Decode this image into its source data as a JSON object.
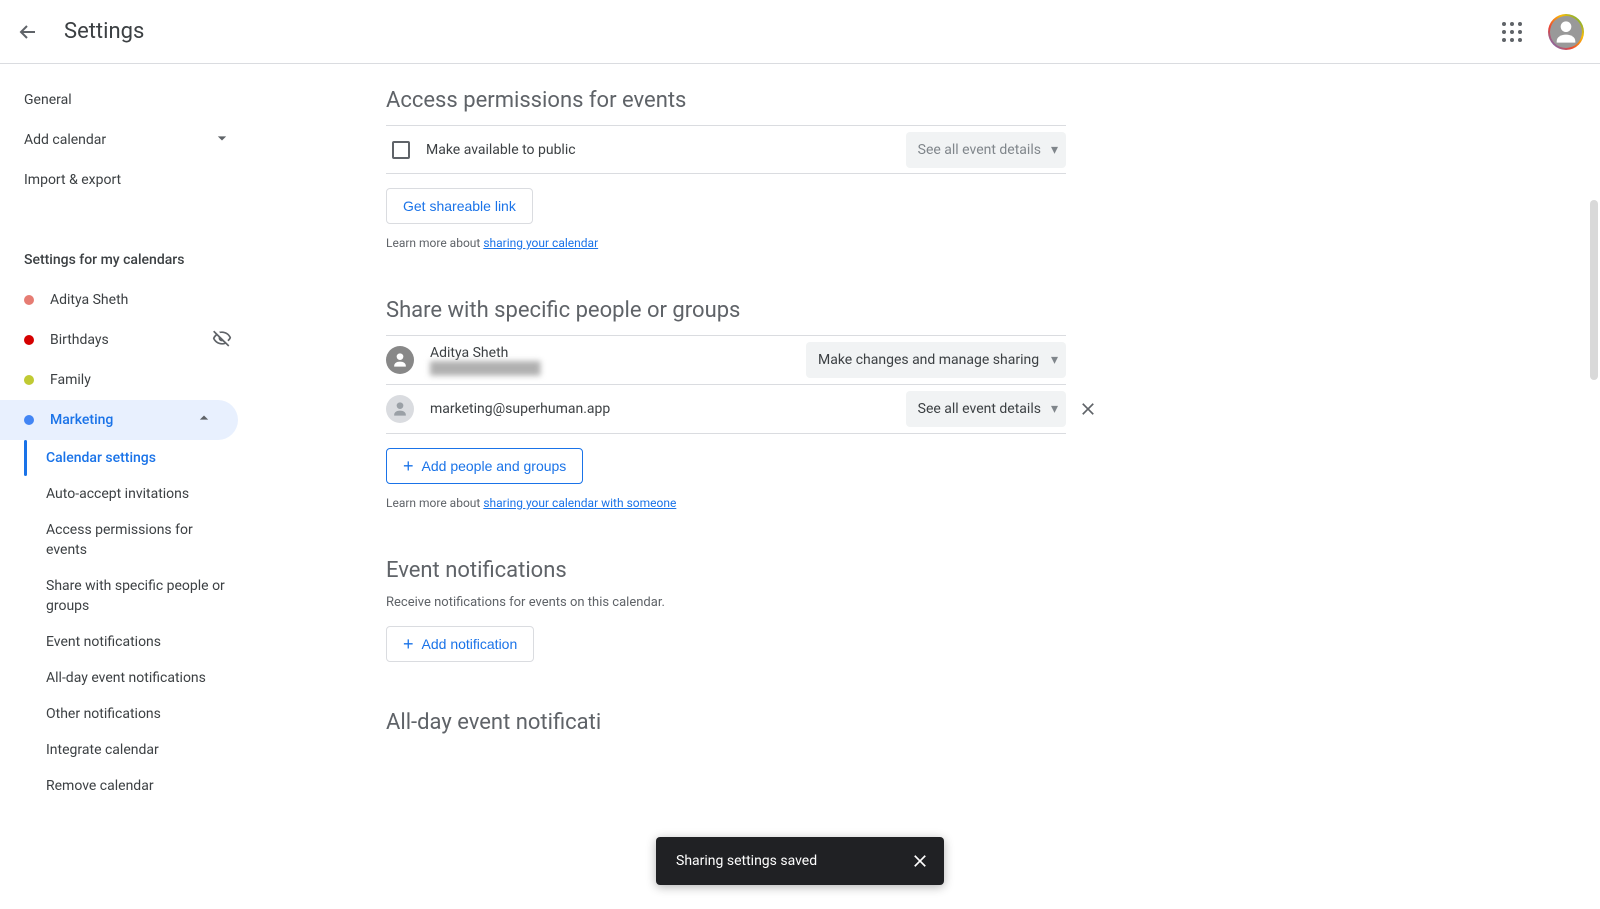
{
  "header": {
    "title": "Settings"
  },
  "sidebar": {
    "general": "General",
    "add_calendar": "Add calendar",
    "import_export": "Import & export",
    "settings_group_title": "Settings for my calendars",
    "calendars": [
      {
        "name": "Aditya Sheth",
        "color": "#e67c73"
      },
      {
        "name": "Birthdays",
        "color": "#d50000",
        "hidden": true
      },
      {
        "name": "Family",
        "color": "#c0ca33"
      },
      {
        "name": "Marketing",
        "color": "#4285f4",
        "selected": true
      }
    ],
    "sub_items": {
      "calendar_settings": "Calendar settings",
      "auto_accept": "Auto-accept invitations",
      "access_perm": "Access permissions for events",
      "share_specific": "Share with specific people or groups",
      "event_notif": "Event notifications",
      "allday_notif": "All-day event notifications",
      "other_notif": "Other notifications",
      "integrate": "Integrate calendar",
      "remove": "Remove calendar"
    }
  },
  "sections": {
    "access": {
      "title": "Access permissions for events",
      "public_label": "Make available to public",
      "visibility_dropdown": "See all event details",
      "shareable_btn": "Get shareable link",
      "learn_prefix": "Learn more about ",
      "learn_link": "sharing your calendar"
    },
    "share": {
      "title": "Share with specific people or groups",
      "owner_name": "Aditya Sheth",
      "owner_email_redacted": "█████████████",
      "owner_perm": "Make changes and manage sharing",
      "guest_email": "marketing@superhuman.app",
      "guest_perm": "See all event details",
      "add_btn": "Add people and groups",
      "learn_prefix": "Learn more about ",
      "learn_link": "sharing your calendar with someone"
    },
    "notif": {
      "title": "Event notifications",
      "desc": "Receive notifications for events on this calendar.",
      "add_btn": "Add notification"
    },
    "allday": {
      "title": "All-day event notificati"
    }
  },
  "toast": {
    "message": "Sharing settings saved"
  }
}
